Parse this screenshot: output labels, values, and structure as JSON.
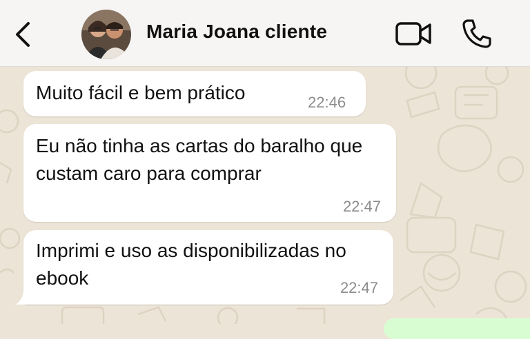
{
  "header": {
    "contact_name": "Maria Joana cliente",
    "icons": {
      "back": "chevron-left-icon",
      "video": "video-camera-icon",
      "call": "phone-icon"
    }
  },
  "messages": [
    {
      "text": "Muito fácil e bem prático",
      "time": "22:46"
    },
    {
      "text": "Eu não tinha as cartas do baralho que custam caro para comprar",
      "time": "22:47"
    },
    {
      "text": "Imprimi e uso as disponibilizadas no ebook",
      "time": "22:47"
    }
  ],
  "colors": {
    "header_bg": "#f6f5f3",
    "chat_bg": "#ece4d6",
    "incoming_bubble": "#ffffff",
    "outgoing_bubble": "#d9fdd3",
    "timestamp": "#8c8c8c"
  }
}
